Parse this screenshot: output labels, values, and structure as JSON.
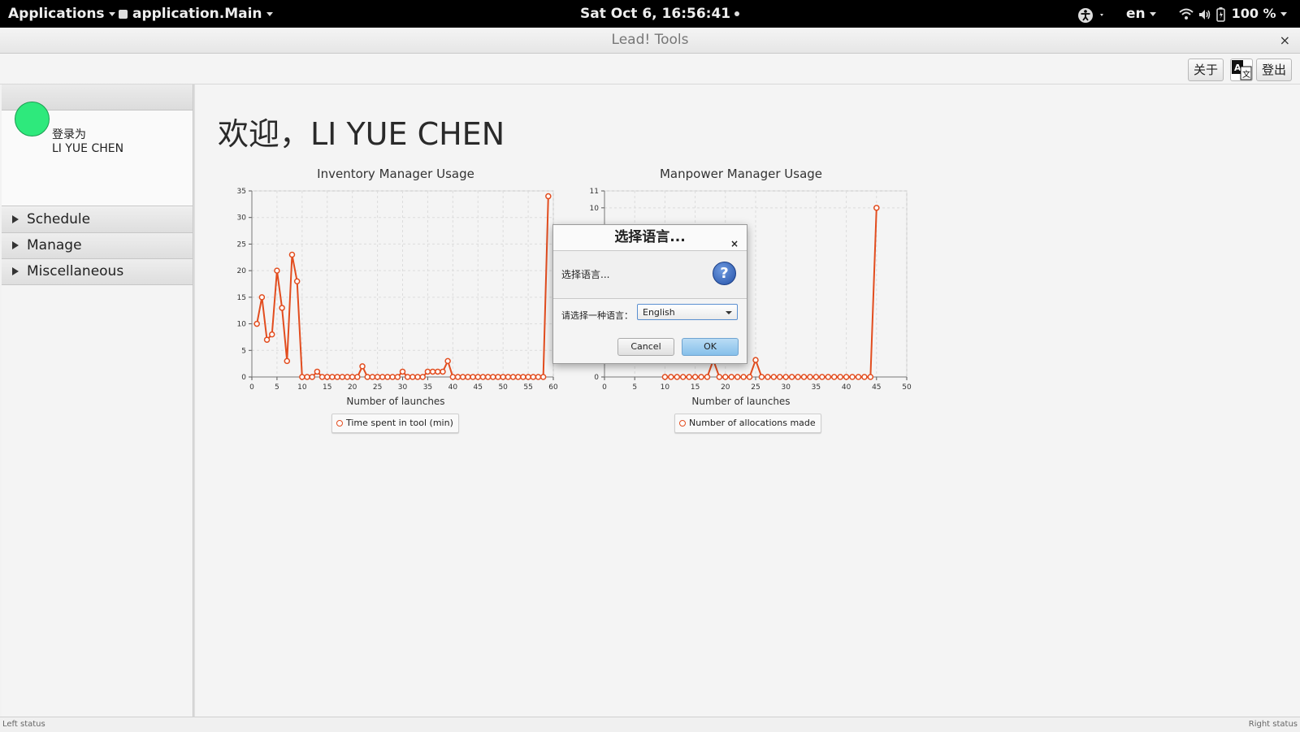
{
  "topbar": {
    "applications": "Applications",
    "app_menu": "application.Main",
    "clock": "Sat Oct  6, 16:56:41",
    "input_lang": "en",
    "battery": "100 %",
    "icons": [
      "accessibility-icon",
      "wifi-icon",
      "volume-icon",
      "battery-icon"
    ]
  },
  "window": {
    "title": "Lead! Tools",
    "close": "×"
  },
  "toolbar": {
    "about": "关于",
    "translate_icon": "translate-icon",
    "logout": "登出"
  },
  "sidebar": {
    "user": {
      "logged_in_as": "登录为",
      "name": "LI YUE CHEN",
      "avatar_color": "#2ee97c"
    },
    "sections": [
      {
        "label": "Schedule"
      },
      {
        "label": "Manage"
      },
      {
        "label": "Miscellaneous"
      }
    ]
  },
  "main": {
    "welcome": "欢迎，LI YUE CHEN"
  },
  "colors": {
    "series": "#e24d1f",
    "ok_button": "#86c0ea"
  },
  "chart_data": [
    {
      "type": "line",
      "title": "Inventory Manager Usage",
      "xlabel": "Number of launches",
      "ylabel": "",
      "xlim": [
        0,
        60
      ],
      "ylim": [
        0,
        35
      ],
      "xticks": [
        0,
        5,
        10,
        15,
        20,
        25,
        30,
        35,
        40,
        45,
        50,
        55,
        60
      ],
      "yticks": [
        0,
        5,
        10,
        15,
        20,
        25,
        30,
        35
      ],
      "grid": true,
      "legend_position": "bottom",
      "series": [
        {
          "name": "Time spent in tool (min)",
          "x": [
            1,
            2,
            3,
            4,
            5,
            6,
            7,
            8,
            9,
            10,
            11,
            12,
            13,
            14,
            15,
            16,
            17,
            18,
            19,
            20,
            21,
            22,
            23,
            24,
            25,
            26,
            27,
            28,
            29,
            30,
            31,
            32,
            33,
            34,
            35,
            36,
            37,
            38,
            39,
            40,
            41,
            42,
            43,
            44,
            45,
            46,
            47,
            48,
            49,
            50,
            51,
            52,
            53,
            54,
            55,
            56,
            57,
            58,
            59
          ],
          "y": [
            10,
            15,
            7,
            8,
            20,
            13,
            3,
            23,
            18,
            0,
            0,
            0,
            1,
            0,
            0,
            0,
            0,
            0,
            0,
            0,
            0,
            2,
            0,
            0,
            0,
            0,
            0,
            0,
            0,
            1,
            0,
            0,
            0,
            0,
            1,
            1,
            1,
            1,
            3,
            0,
            0,
            0,
            0,
            0,
            0,
            0,
            0,
            0,
            0,
            0,
            0,
            0,
            0,
            0,
            0,
            0,
            0,
            0,
            34
          ]
        }
      ]
    },
    {
      "type": "line",
      "title": "Manpower Manager Usage",
      "xlabel": "Number of launches",
      "ylabel": "",
      "xlim": [
        0,
        50
      ],
      "ylim": [
        0,
        11
      ],
      "xticks": [
        0,
        5,
        10,
        15,
        20,
        25,
        30,
        35,
        40,
        45,
        50
      ],
      "yticks": [
        0,
        10,
        11
      ],
      "grid": true,
      "legend_position": "bottom",
      "series": [
        {
          "name": "Number of allocations made",
          "x": [
            10,
            11,
            12,
            13,
            14,
            15,
            16,
            17,
            18,
            19,
            20,
            21,
            22,
            23,
            24,
            25,
            26,
            27,
            28,
            29,
            30,
            31,
            32,
            33,
            34,
            35,
            36,
            37,
            38,
            39,
            40,
            41,
            42,
            43,
            44,
            45
          ],
          "y": [
            0,
            0,
            0,
            0,
            0,
            0,
            0,
            0,
            1,
            0,
            0,
            0,
            0,
            0,
            0,
            1,
            0,
            0,
            0,
            0,
            0,
            0,
            0,
            0,
            0,
            0,
            0,
            0,
            0,
            0,
            0,
            0,
            0,
            0,
            0,
            10
          ]
        }
      ]
    }
  ],
  "dialog": {
    "title": "选择语言...",
    "close": "×",
    "header_text": "选择语言...",
    "question_icon": "?",
    "prompt": "请选择一种语言：",
    "selected_language": "English",
    "cancel": "Cancel",
    "ok": "OK"
  },
  "statusbar": {
    "left": "Left status",
    "right": "Right status"
  }
}
